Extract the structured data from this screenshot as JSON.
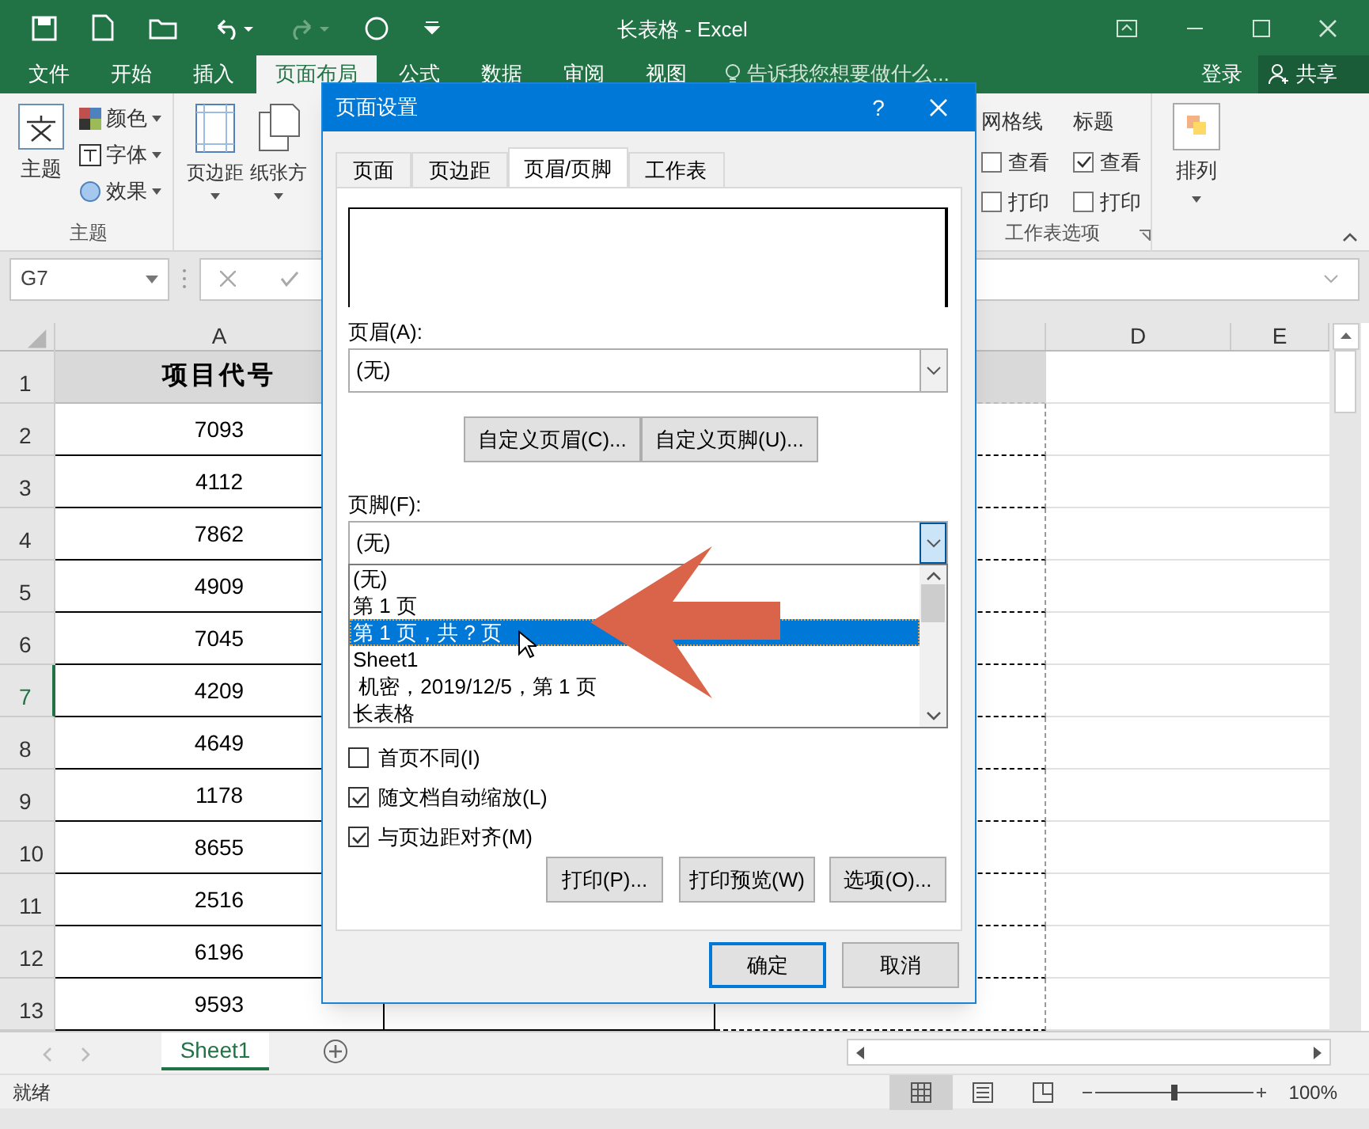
{
  "window": {
    "title": "长表格 - Excel"
  },
  "menu_tabs": [
    {
      "label": "文件",
      "selected": false
    },
    {
      "label": "开始",
      "selected": false
    },
    {
      "label": "插入",
      "selected": false
    },
    {
      "label": "页面布局",
      "selected": true
    },
    {
      "label": "公式",
      "selected": false
    },
    {
      "label": "数据",
      "selected": false
    },
    {
      "label": "审阅",
      "selected": false
    },
    {
      "label": "视图",
      "selected": false
    }
  ],
  "tell_me": {
    "placeholder": "告诉我您想要做什么..."
  },
  "sign_in": "登录",
  "share": "共享",
  "ribbon": {
    "theme_group": {
      "theme": "主题",
      "items": [
        "颜色",
        "字体",
        "效果"
      ],
      "label": "主题"
    },
    "page_setup": [
      "页边距",
      "纸张方"
    ],
    "sheet_options": {
      "gridlines": {
        "title": "网格线",
        "view": {
          "label": "查看",
          "checked": false
        },
        "print": {
          "label": "打印",
          "checked": false
        }
      },
      "headings": {
        "title": "标题",
        "view": {
          "label": "查看",
          "checked": true
        },
        "print": {
          "label": "打印",
          "checked": false
        }
      },
      "label": "工作表选项"
    },
    "arrange": "排列"
  },
  "name_box": "G7",
  "columns": [
    "A",
    "D",
    "E"
  ],
  "rows": [
    {
      "n": "1",
      "a": "项目代号",
      "header": true,
      "selected": false
    },
    {
      "n": "2",
      "a": "7093",
      "selected": false
    },
    {
      "n": "3",
      "a": "4112",
      "selected": false
    },
    {
      "n": "4",
      "a": "7862",
      "selected": false
    },
    {
      "n": "5",
      "a": "4909",
      "selected": false
    },
    {
      "n": "6",
      "a": "7045",
      "selected": false
    },
    {
      "n": "7",
      "a": "4209",
      "selected": true
    },
    {
      "n": "8",
      "a": "4649",
      "selected": false
    },
    {
      "n": "9",
      "a": "1178",
      "selected": false
    },
    {
      "n": "10",
      "a": "8655",
      "selected": false
    },
    {
      "n": "11",
      "a": "2516",
      "selected": false
    },
    {
      "n": "12",
      "a": "6196",
      "selected": false
    },
    {
      "n": "13",
      "a": "9593",
      "selected": false
    }
  ],
  "sheet_tabs": [
    {
      "label": "Sheet1",
      "selected": true
    }
  ],
  "status_bar": {
    "text": "就绪",
    "zoom": "100%",
    "zoom_slider": {
      "level": 0.5
    }
  },
  "dialog": {
    "title": "页面设置",
    "help": "?",
    "tabs": [
      {
        "label": "页面",
        "selected": false
      },
      {
        "label": "页边距",
        "selected": false
      },
      {
        "label": "页眉/页脚",
        "selected": true
      },
      {
        "label": "工作表",
        "selected": false
      }
    ],
    "header_label": "页眉(A):",
    "header_value": "(无)",
    "custom_buttons": [
      "自定义页眉(C)...",
      "自定义页脚(U)..."
    ],
    "footer_label": "页脚(F):",
    "footer_value": "(无)",
    "footer_options": [
      {
        "label": "(无)",
        "selected": false
      },
      {
        "label": "第 1 页",
        "selected": false
      },
      {
        "label": "第 1 页，共 ? 页",
        "selected": true
      },
      {
        "label": "Sheet1",
        "selected": false
      },
      {
        "label": " 机密，2019/12/5，第 1 页",
        "selected": false
      },
      {
        "label": "长表格",
        "selected": false
      }
    ],
    "checkboxes": [
      {
        "label": "首页不同(I)",
        "checked": false
      },
      {
        "label": "随文档自动缩放(L)",
        "checked": true
      },
      {
        "label": "与页边距对齐(M)",
        "checked": true
      }
    ],
    "action_buttons": [
      "打印(P)...",
      "打印预览(W)",
      "选项(O)..."
    ],
    "ok": "确定",
    "cancel": "取消"
  }
}
